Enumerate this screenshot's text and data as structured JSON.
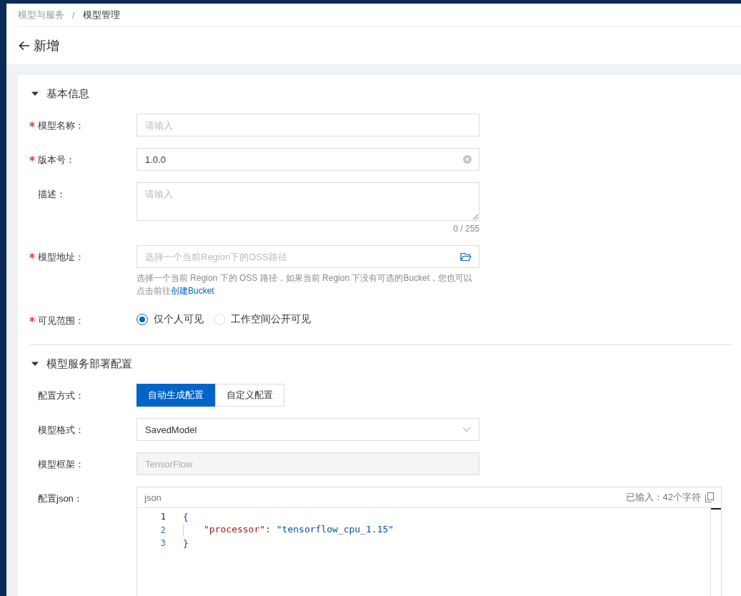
{
  "breadcrumb": {
    "separator": "/",
    "items": [
      {
        "label": "模型与服务",
        "current": false
      },
      {
        "label": "模型管理",
        "current": true
      }
    ]
  },
  "page_title": "新增",
  "sections": [
    {
      "title": "基本信息",
      "expanded": true,
      "fields": [
        {
          "kind": "input",
          "label": "模型名称：",
          "required": true,
          "placeholder": "请输入"
        },
        {
          "kind": "input",
          "label": "版本号：",
          "required": true,
          "value": "1.0.0",
          "clearable": true
        },
        {
          "kind": "textarea",
          "label": "描述：",
          "required": false,
          "placeholder": "请输入",
          "counter": "0 / 255"
        },
        {
          "kind": "path",
          "label": "模型地址：",
          "required": true,
          "placeholder": "选择一个当前Region下的OSS路径",
          "help": "选择一个当前 Region 下的 OSS 路径，如果当前 Region 下没有可选的Bucket，您也可以点击前往",
          "help_link": "创建Bucket"
        },
        {
          "kind": "radio",
          "label": "可见范围：",
          "required": true,
          "options": [
            {
              "label": "仅个人可见",
              "selected": true
            },
            {
              "label": "工作空间公开可见",
              "selected": false
            }
          ]
        }
      ]
    },
    {
      "title": "模型服务部署配置",
      "expanded": true,
      "fields": [
        {
          "kind": "segmented",
          "label": "配置方式：",
          "required": false,
          "options": [
            {
              "label": "自动生成配置",
              "selected": true
            },
            {
              "label": "自定义配置",
              "selected": false
            }
          ]
        },
        {
          "kind": "select",
          "label": "模型格式：",
          "required": false,
          "value": "SavedModel"
        },
        {
          "kind": "input",
          "label": "模型框架：",
          "required": false,
          "value": "TensorFlow",
          "disabled": true
        },
        {
          "kind": "code",
          "label": "配置json：",
          "required": false,
          "language": "json",
          "count": "已输入：42个字符",
          "lines": [
            {
              "number": "1",
              "current": true,
              "indented": false,
              "tokens": [
                {
                  "kind": "brace",
                  "text": "{"
                }
              ]
            },
            {
              "number": "2",
              "current": false,
              "indented": true,
              "tokens": [
                {
                  "kind": "key",
                  "text": "\"processor\""
                },
                {
                  "kind": "punct",
                  "text": ": "
                },
                {
                  "kind": "string",
                  "text": "\"tensorflow_cpu_1.15\""
                }
              ]
            },
            {
              "number": "3",
              "current": false,
              "indented": false,
              "tokens": [
                {
                  "kind": "brace",
                  "text": "}"
                }
              ]
            }
          ]
        }
      ]
    }
  ]
}
